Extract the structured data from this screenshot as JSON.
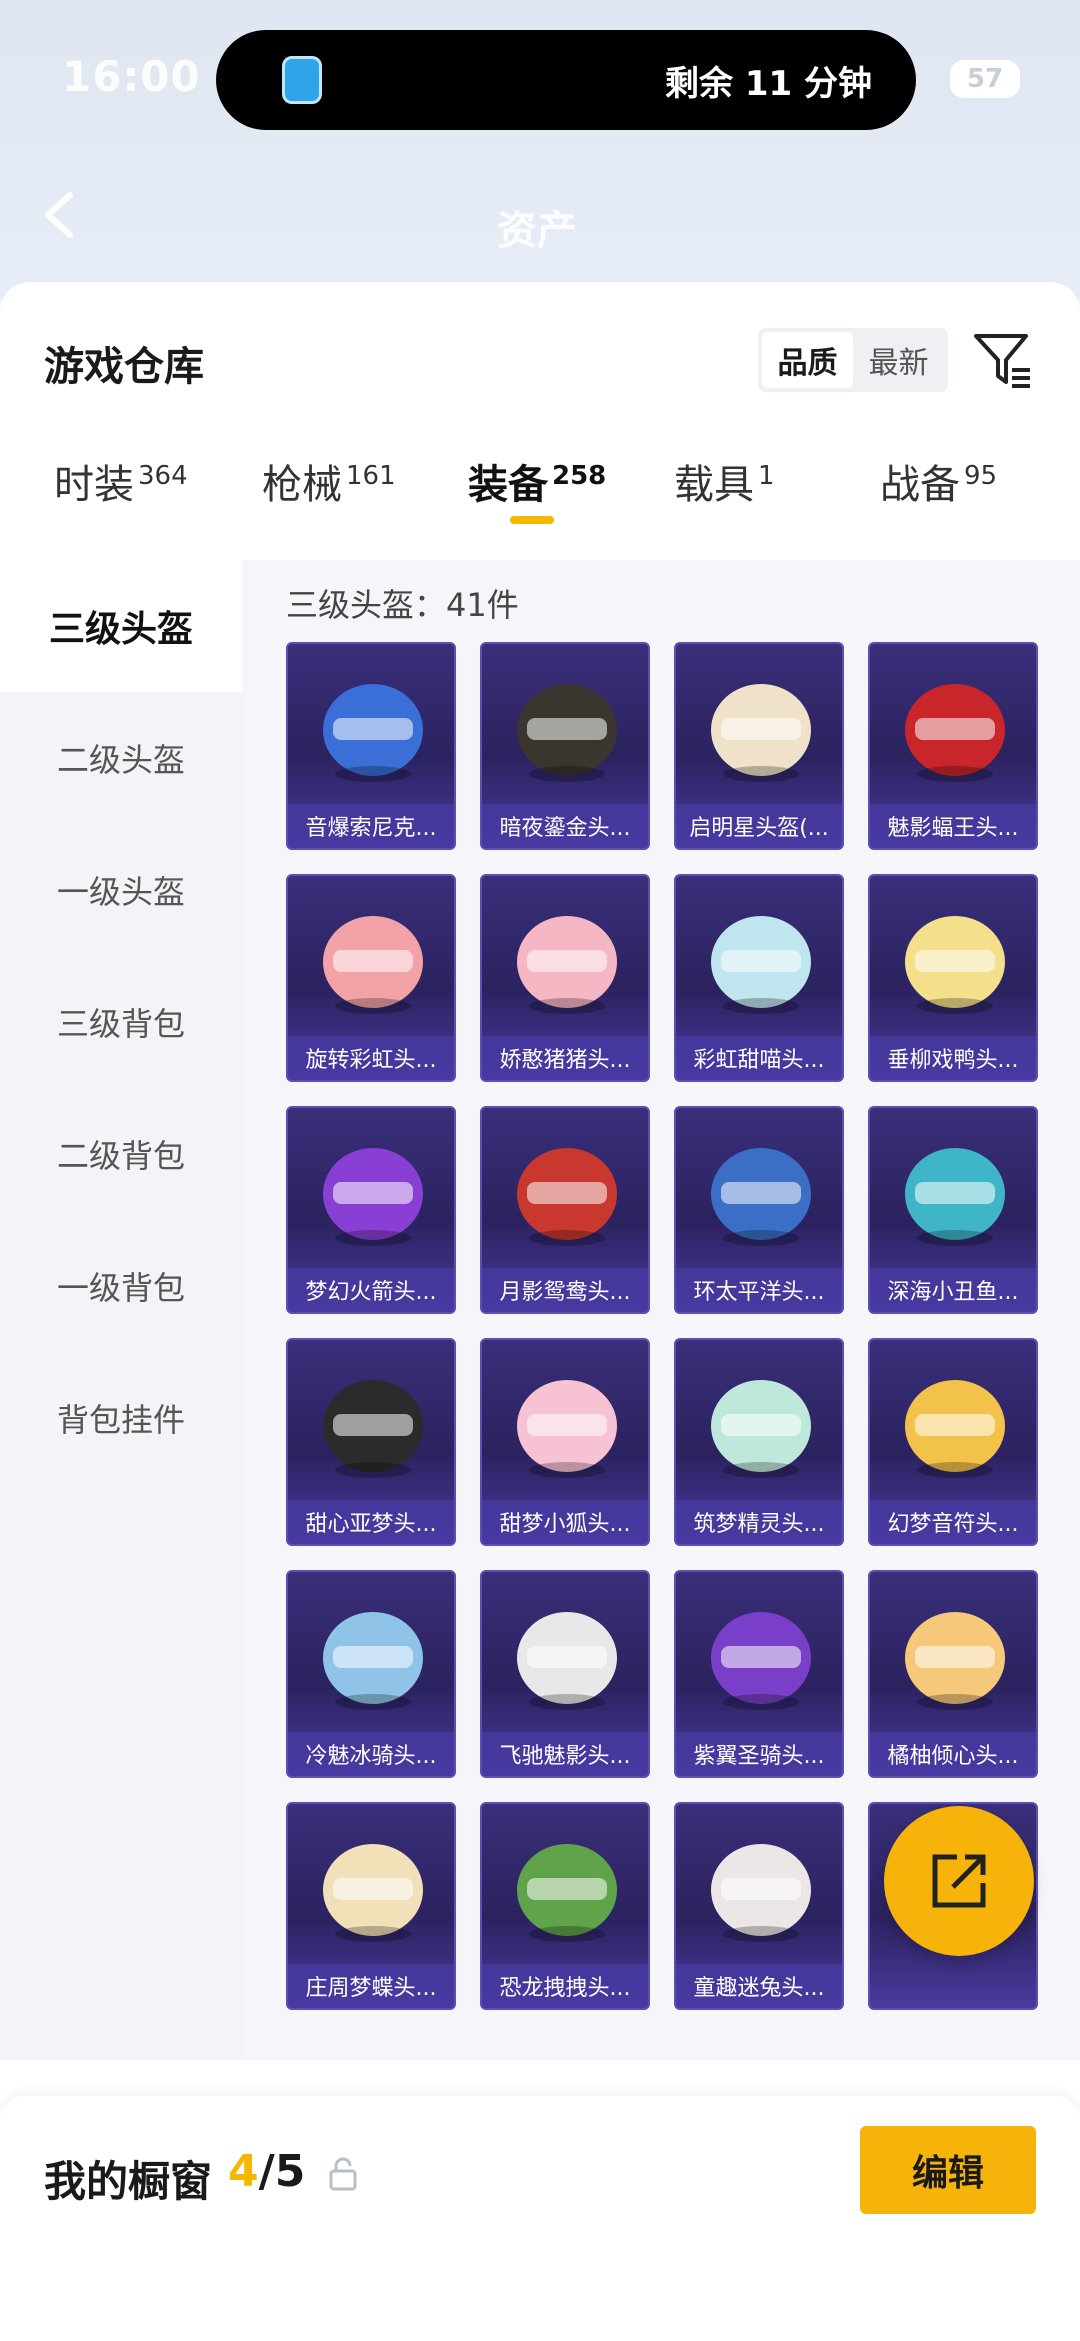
{
  "status": {
    "time": "16:00",
    "battery": "57"
  },
  "island": {
    "text": "剩余 11 分钟"
  },
  "page": {
    "title": "资产"
  },
  "sheet": {
    "title": "游戏仓库",
    "sort": [
      "品质",
      "最新"
    ],
    "tabs": [
      {
        "label": "时装",
        "count": "364"
      },
      {
        "label": "枪械",
        "count": "161"
      },
      {
        "label": "装备",
        "count": "258"
      },
      {
        "label": "载具",
        "count": "1"
      },
      {
        "label": "战备",
        "count": "95"
      }
    ],
    "categories": [
      "三级头盔",
      "二级头盔",
      "一级头盔",
      "三级背包",
      "二级背包",
      "一级背包",
      "背包挂件"
    ],
    "count_label": "三级头盔：41件",
    "items": [
      "音爆索尼克...",
      "暗夜鎏金头...",
      "启明星头盔(...",
      "魅影蝠王头...",
      "旋转彩虹头...",
      "娇憨猪猪头...",
      "彩虹甜喵头...",
      "垂柳戏鸭头...",
      "梦幻火箭头...",
      "月影鸳鸯头...",
      "环太平洋头...",
      "深海小丑鱼...",
      "甜心亚梦头...",
      "甜梦小狐头...",
      "筑梦精灵头...",
      "幻梦音符头...",
      "冷魅冰骑头...",
      "飞驰魅影头...",
      "紫翼圣骑头...",
      "橘柚倾心头...",
      "庄周梦蝶头...",
      "恐龙拽拽头...",
      "童趣迷兔头...",
      ""
    ],
    "item_colors": [
      "#3a6fd8",
      "#3b3530",
      "#f0e2c8",
      "#c8262a",
      "#f3a3a8",
      "#f6b7c4",
      "#bfe5ee",
      "#f4e08a",
      "#8a3fd4",
      "#c8382e",
      "#3b6fc6",
      "#3fb6c8",
      "#2b2b2b",
      "#f7c2d4",
      "#bfe8dc",
      "#f3c24a",
      "#8fc4e8",
      "#e8e8e8",
      "#7a3fc8",
      "#f5c87a",
      "#f2e0b8",
      "#5fa34a",
      "#ece6e6",
      "#3a5f8f"
    ]
  },
  "bottom": {
    "title": "我的橱窗",
    "count_current": "4",
    "count_total": "/5",
    "edit_label": "编辑"
  }
}
